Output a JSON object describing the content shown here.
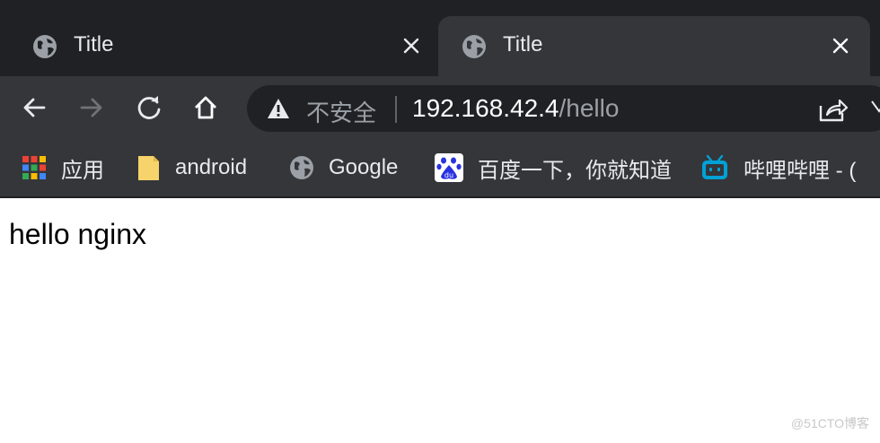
{
  "tabs": [
    {
      "title": "Title",
      "active": false
    },
    {
      "title": "Title",
      "active": true
    }
  ],
  "toolbar": {
    "back_icon": "arrow-left-icon",
    "forward_icon": "arrow-right-icon",
    "reload_icon": "reload-icon",
    "home_icon": "home-icon"
  },
  "omnibox": {
    "security_label": "不安全",
    "url_host": "192.168.42.4",
    "url_path": "/hello"
  },
  "bookmarks": [
    {
      "label": "应用",
      "icon": "apps-grid-icon"
    },
    {
      "label": "android",
      "icon": "folder-icon"
    },
    {
      "label": "Google",
      "icon": "globe-icon"
    },
    {
      "label": "百度一下，你就知道",
      "icon": "baidu-icon"
    },
    {
      "label": "哔哩哔哩 - (",
      "icon": "bilibili-icon"
    }
  ],
  "page": {
    "text": "hello nginx"
  },
  "watermark": "@51CTO博客",
  "colors": {
    "tab_strip_bg": "#202124",
    "toolbar_bg": "#35363a",
    "omnibox_bg": "#202124",
    "bilibili_blue": "#00a1d6",
    "folder_yellow": "#f6d36b"
  }
}
